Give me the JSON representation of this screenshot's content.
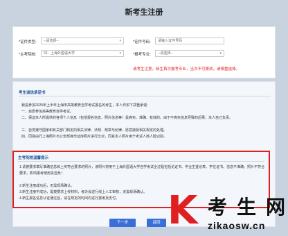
{
  "header": {
    "title": "新考生注册"
  },
  "form": {
    "cert_type_label": "*证件类型:",
    "cert_type_value": "--请选择--",
    "cert_no_label": "*证件号码:",
    "cert_no_placeholder": "请输入证件号码",
    "school_label": "*主考院校:",
    "school_value": "32 - 上海外国语大学",
    "major_label": "*报考专业:",
    "major_value": "--请选择--",
    "warning": "请考生注意，新生首次报考专业，当次不可更改，请慎重选择。"
  },
  "commitment": {
    "title": "考生诚信承诺书",
    "lines": [
      "我是参加2025年上半年上海市高等教育自学考试报名的考生，本人作如下郑重承诺:",
      "一、自愿参加高等教育自学考试。",
      "二、保证本人所提供的各项个人信息（包括报名信息、照片信息等）是真实、准确、有效的。由于不真实信息导致的后果，本人自己负责。",
      "三、自觉遵守国家和有关部门制定的相关法律、法规、规章与纪律，愿意接受相关规定的处理。",
      "四、同意由行上海照片与公安部身份证库照片进行比对，同意本人照片用于考试人核人脸识别。"
    ]
  },
  "notice": {
    "title": "主考院校温馨提示",
    "lines": [
      "1.请按要求填写准确信息和上传符合要求的照片，该照片将用于上海外国语大学自学考试全过程包括论证书、毕业生登记表、学位证书。信息不准确、照片不符合要求，影响报考使用责自负！",
      "2.新生注册成功后，无需现场确认。",
      "3.新生注册不成功，需按要求上传材料，考办会进行线上人工审核，无需现场确认。",
      "4.新生报名信息认证通过后，请在规定的时间内进行报考及支付。"
    ]
  },
  "buttons": {
    "next": "下一步",
    "back": "返回"
  },
  "watermark": {
    "k": "K",
    "cn": "考生网",
    "url": "zikaosw.cn"
  },
  "colors": {
    "accent": "#3a6fd8",
    "warning": "#e02020",
    "section_title": "#2a5a9e"
  }
}
